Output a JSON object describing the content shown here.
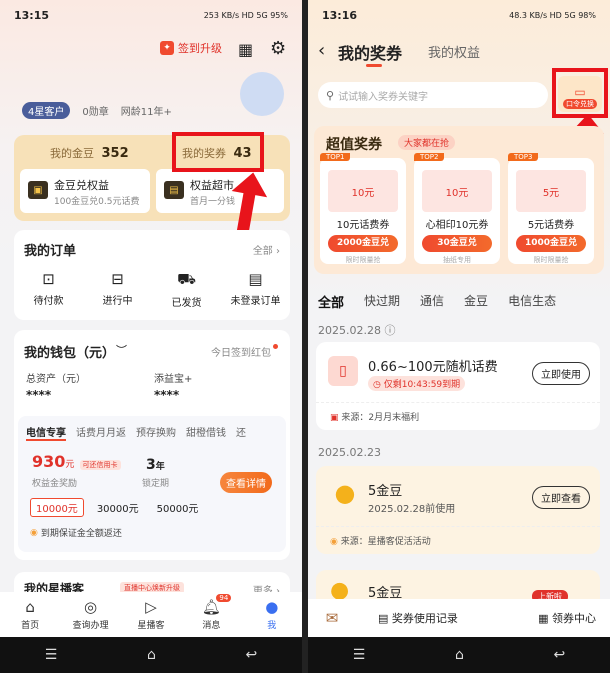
{
  "left": {
    "status": {
      "time": "13:15",
      "indicators": "253 KB/s  HD  5G  95%"
    },
    "header": {
      "signin_label": "签到升级"
    },
    "profile": {
      "level_badge": "4星客户",
      "medals": "0勋章",
      "net_age": "网龄11年+"
    },
    "assets": {
      "gold_label": "我的金豆",
      "gold_value": "352",
      "coupon_label": "我的奖券",
      "coupon_value": "43",
      "card1_title": "金豆兑权益",
      "card1_sub": "100金豆兑0.5元话费",
      "card2_title": "权益超市",
      "card2_sub": "首月一分钱"
    },
    "orders": {
      "title": "我的订单",
      "all_label": "全部",
      "items": [
        "待付款",
        "进行中",
        "已发货",
        "未登录订单"
      ]
    },
    "wallet": {
      "title": "我的钱包（元）",
      "signin_hint": "今日签到红包",
      "total_label": "总资产（元）",
      "total_value": "****",
      "plus_label": "添益宝+",
      "plus_value": "****",
      "tabs": [
        "电信专享",
        "话费月月返",
        "预存换购",
        "甜橙借钱",
        "还"
      ],
      "amount": "930",
      "amount_unit": "元",
      "amount_tag": "可还信用卡",
      "amount_sub": "权益金奖励",
      "years": "3",
      "years_unit": "年",
      "years_sub": "锁定期",
      "detail_btn": "查看详情",
      "options": [
        "10000元",
        "30000元",
        "50000元"
      ],
      "note": "到期保证金全额返还"
    },
    "star": {
      "title": "我的星播客",
      "tag": "直播中心焕新升级",
      "more": "更多"
    },
    "tabbar": [
      "首页",
      "查询办理",
      "星播客",
      "消息",
      "我"
    ],
    "msg_badge": "94"
  },
  "right": {
    "status": {
      "time": "13:16",
      "indicators": "48.3 KB/s  HD  5G  98%"
    },
    "header": {
      "title": "我的奖券",
      "tab2": "我的权益"
    },
    "search": {
      "placeholder": "试试输入奖券关键字"
    },
    "exchange_label": "口令兑换",
    "promo": {
      "title": "超值奖券",
      "tag": "大家都在抢",
      "coupons": [
        {
          "top": "TOP1",
          "img": "10元",
          "name": "10元话费券",
          "btn": "2000金豆兑",
          "foot": "限时限量抢"
        },
        {
          "top": "TOP2",
          "img": "10元",
          "name": "心相印10元券",
          "btn": "30金豆兑",
          "foot": "抽纸专用"
        },
        {
          "top": "TOP3",
          "img": "5元",
          "name": "5元话费券",
          "btn": "1000金豆兑",
          "foot": "限时限量抢"
        }
      ]
    },
    "filters": [
      "全部",
      "快过期",
      "通信",
      "金豆",
      "电信生态"
    ],
    "groups": [
      {
        "date": "2025.02.28",
        "title": "0.66~100元随机话费",
        "sub": "仅剩10:43:59到期",
        "btn": "立即使用",
        "source": "来源：2月月末福利"
      },
      {
        "date": "2025.02.23",
        "title": "5金豆",
        "sub": "2025.02.28前使用",
        "btn": "立即查看",
        "source": "来源：星播客促活活动"
      }
    ],
    "third_title": "5金豆",
    "new_tag": "上新啦",
    "bottom": {
      "record": "奖券使用记录",
      "center": "领券中心"
    }
  },
  "colors": {
    "accent": "#f26a1b",
    "highlight": "#e8141b",
    "brand_red": "#e0322a"
  }
}
